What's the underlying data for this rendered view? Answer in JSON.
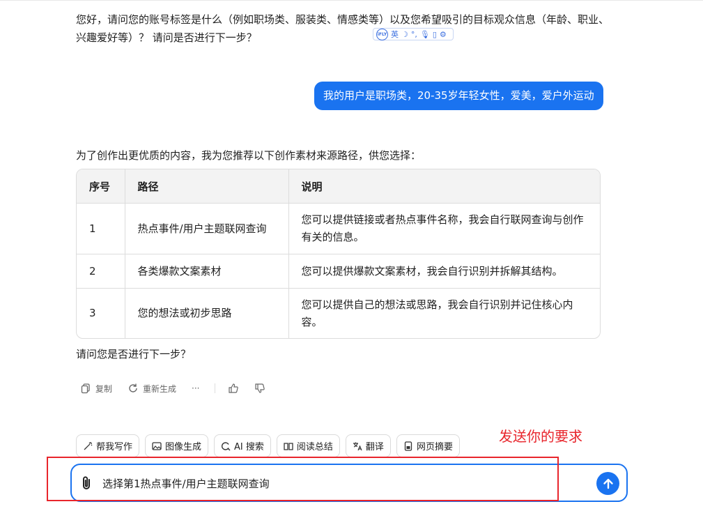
{
  "intro_text": "您好，请问您的账号标签是什么（例如职场类、服装类、情感类等）以及您希望吸引的目标观众信息（年龄、职业、兴趣爱好等）？ 请问是否进行下一步？",
  "ime_toolbar": {
    "logo": "iFLY",
    "lang": "英"
  },
  "user_message": "我的用户是职场类，20-35岁年轻女性，爱美，爱户外运动",
  "reply_intro": "为了创作出更优质的内容，我为您推荐以下创作素材来源路径，供您选择：",
  "table": {
    "headers": [
      "序号",
      "路径",
      "说明"
    ],
    "rows": [
      [
        "1",
        "热点事件/用户主题联网查询",
        "您可以提供链接或者热点事件名称，我会自行联网查询与创作有关的信息。"
      ],
      [
        "2",
        "各类爆款文案素材",
        "您可以提供爆款文案素材，我会自行识别并拆解其结构。"
      ],
      [
        "3",
        "您的想法或初步思路",
        "您可以提供自己的想法或思路，我会自行识别并记住核心内容。"
      ]
    ]
  },
  "reply_question": "请问您是否进行下一步？",
  "actions": {
    "copy": "复制",
    "regenerate": "重新生成",
    "more": "···"
  },
  "tools": [
    "帮我写作",
    "图像生成",
    "AI 搜索",
    "阅读总结",
    "翻译",
    "网页摘要"
  ],
  "annotation": "发送你的要求",
  "input": {
    "value": "选择第1热点事件/用户主题联网查询"
  },
  "colors": {
    "accent": "#1a73f0",
    "annotation": "#e8252c"
  }
}
